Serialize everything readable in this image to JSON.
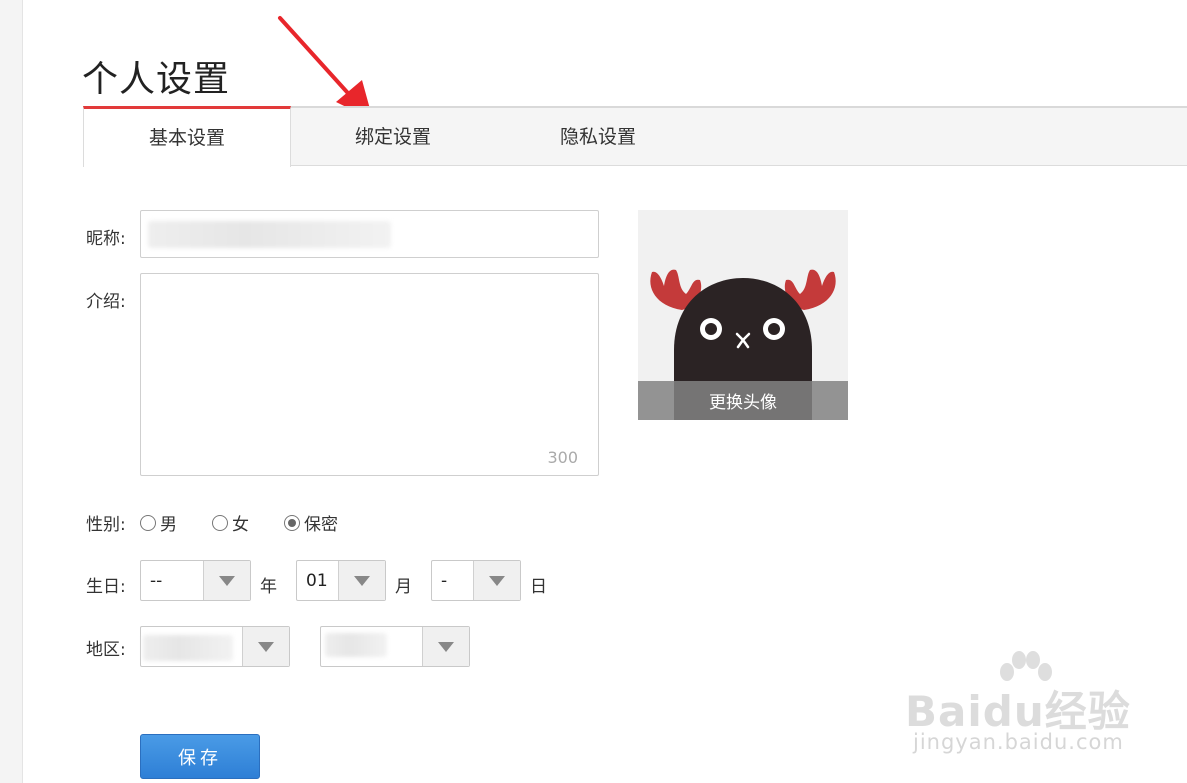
{
  "page": {
    "title": "个人设置"
  },
  "tabs": [
    {
      "label": "基本设置",
      "active": true
    },
    {
      "label": "绑定设置",
      "active": false
    },
    {
      "label": "隐私设置",
      "active": false
    }
  ],
  "form": {
    "nickname": {
      "label": "昵称:",
      "value": ""
    },
    "intro": {
      "label": "介绍:",
      "value": "",
      "counter": "300"
    },
    "gender": {
      "label": "性别:",
      "options": [
        {
          "label": "男",
          "checked": false
        },
        {
          "label": "女",
          "checked": false
        },
        {
          "label": "保密",
          "checked": true
        }
      ]
    },
    "birthday": {
      "label": "生日:",
      "year": {
        "value": "--",
        "unit": "年"
      },
      "month": {
        "value": "01",
        "unit": "月"
      },
      "day": {
        "value": "-",
        "unit": "日"
      }
    },
    "region": {
      "label": "地区:",
      "province": "",
      "city": ""
    },
    "save_label": "保存"
  },
  "avatar": {
    "change_label": "更换头像"
  },
  "watermark": {
    "main": "Baidu经验",
    "sub": "jingyan.baidu.com"
  },
  "colors": {
    "tab_accent": "#e23a3a",
    "annotation_arrow": "#e8262b",
    "save_button": "#2e7fd6"
  },
  "icons": [
    "dropdown-arrow-icon",
    "radio-icon",
    "annotation-arrow-icon",
    "moose-avatar-icon",
    "baidu-paw-icon"
  ]
}
